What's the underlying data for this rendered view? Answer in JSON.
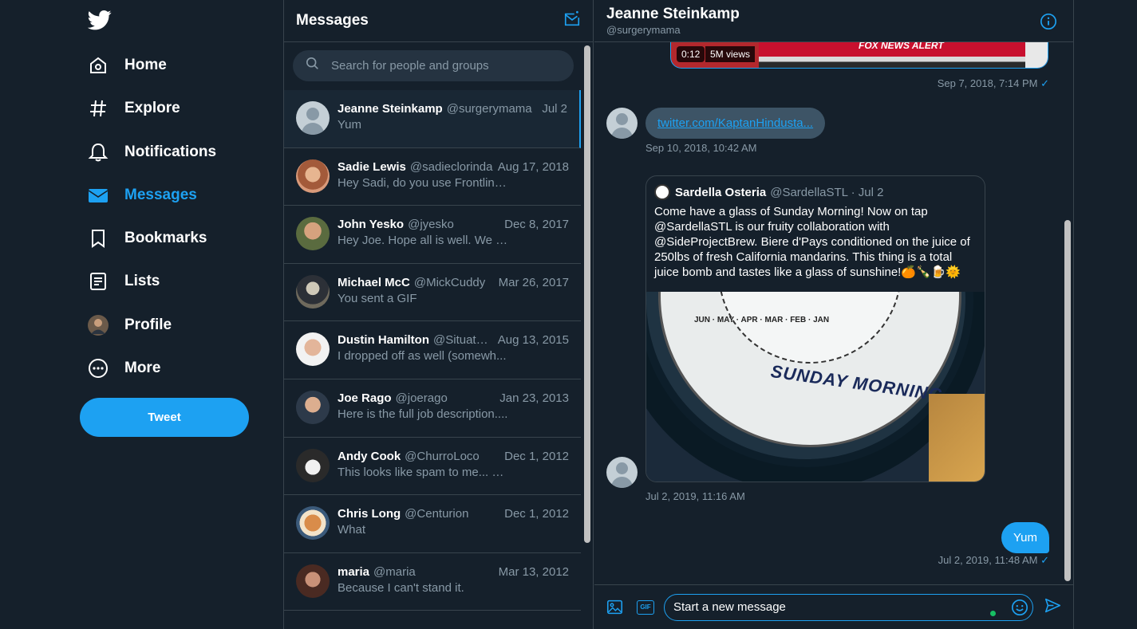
{
  "nav": {
    "items": [
      {
        "label": "Home",
        "icon": "home-icon"
      },
      {
        "label": "Explore",
        "icon": "hashtag-icon"
      },
      {
        "label": "Notifications",
        "icon": "bell-icon"
      },
      {
        "label": "Messages",
        "icon": "envelope-icon",
        "active": true
      },
      {
        "label": "Bookmarks",
        "icon": "bookmark-icon"
      },
      {
        "label": "Lists",
        "icon": "list-icon"
      },
      {
        "label": "Profile",
        "icon": "avatar"
      },
      {
        "label": "More",
        "icon": "more-icon"
      }
    ],
    "tweet_label": "Tweet"
  },
  "messages": {
    "title": "Messages",
    "search_placeholder": "Search for people and groups",
    "conversations": [
      {
        "name": "Jeanne Steinkamp",
        "handle": "@surgerymama",
        "date": "Jul 2",
        "preview": "Yum",
        "selected": true
      },
      {
        "name": "Sadie Lewis",
        "handle": "@sadieclorinda",
        "date": "Aug 17, 2018",
        "preview": "Hey Sadi, do you use Frontline..."
      },
      {
        "name": "John Yesko",
        "handle": "@jyesko",
        "date": "Dec 8, 2017",
        "preview": "Hey Joe. Hope all is well. We h..."
      },
      {
        "name": "Michael McC",
        "handle": "@MickCuddy",
        "date": "Mar 26, 2017",
        "preview": "You sent a GIF"
      },
      {
        "name": "Dustin Hamilton",
        "handle": "@SituatedA...",
        "date": "Aug 13, 2015",
        "preview": "I dropped off as well (somewh..."
      },
      {
        "name": "Joe Rago",
        "handle": "@joerago",
        "date": "Jan 23, 2013",
        "preview": "Here is the full job description...."
      },
      {
        "name": "Andy Cook",
        "handle": "@ChurroLoco",
        "date": "Dec 1, 2012",
        "preview": "This looks like spam to me... Fa..."
      },
      {
        "name": "Chris Long",
        "handle": "@Centurion",
        "date": "Dec 1, 2012",
        "preview": "What"
      },
      {
        "name": "maria",
        "handle": "@maria",
        "date": "Mar 13, 2012",
        "preview": "Because I can't stand it."
      }
    ]
  },
  "chat": {
    "name": "Jeanne Steinkamp",
    "handle": "@surgerymama",
    "video": {
      "duration": "0:12",
      "views": "5M views",
      "overlay_text": "FOX NEWS ALERT"
    },
    "stamp1": "Sep 7, 2018, 7:14 PM",
    "link_text": "twitter.com/KaptanHindusta...",
    "stamp2": "Sep 10, 2018, 10:42 AM",
    "tweet": {
      "name": "Sardella Osteria",
      "handle": "@SardellaSTL · Jul 2",
      "text": "Come have a glass of Sunday Morning! Now on tap @SardellaSTL is our fruity collaboration with @SideProjectBrew. Biere d'Pays conditioned on the juice of 250lbs of fresh California mandarins. This thing is a total juice bomb and tastes like a glass of sunshine!🍊🍾🍺🌞",
      "image_label": "SUNDAY MORNING",
      "image_ticks": "JUN · MAY · APR · MAR · FEB · JAN"
    },
    "stamp3": "Jul 2, 2019, 11:16 AM",
    "out_message": "Yum",
    "stamp4": "Jul 2, 2019, 11:48 AM",
    "check": "✓",
    "composer_placeholder": "Start a new message",
    "gif_label": "GIF"
  },
  "colors": {
    "accent": "#1da1f2",
    "background": "#15202b",
    "border": "#38444d",
    "muted": "#8899a6"
  }
}
